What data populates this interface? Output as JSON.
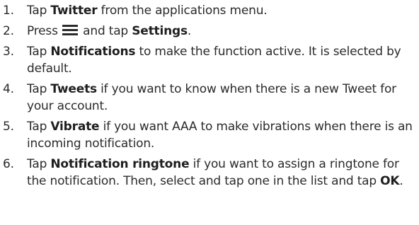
{
  "steps": [
    {
      "number": "1.",
      "parts": [
        {
          "t": "Tap ",
          "b": false
        },
        {
          "t": "Twitter",
          "b": true
        },
        {
          "t": " from the applications menu.",
          "b": false
        }
      ]
    },
    {
      "number": "2.",
      "parts": [
        {
          "t": "Press ",
          "b": false
        },
        {
          "icon": "menu-icon"
        },
        {
          "t": " and tap ",
          "b": false
        },
        {
          "t": "Settings",
          "b": true
        },
        {
          "t": ".",
          "b": false
        }
      ]
    },
    {
      "number": "3.",
      "parts": [
        {
          "t": "Tap ",
          "b": false
        },
        {
          "t": "Notifications",
          "b": true
        },
        {
          "t": " to make the function active. It is selected by default.",
          "b": false
        }
      ]
    },
    {
      "number": "4.",
      "parts": [
        {
          "t": "Tap ",
          "b": false
        },
        {
          "t": "Tweets",
          "b": true
        },
        {
          "t": " if you want to know when there is a new Tweet for your account.",
          "b": false
        }
      ]
    },
    {
      "number": "5.",
      "parts": [
        {
          "t": "Tap ",
          "b": false
        },
        {
          "t": "Vibrate",
          "b": true
        },
        {
          "t": " if you want AAA to make vibrations when there is an incoming notification.",
          "b": false
        }
      ]
    },
    {
      "number": "6.",
      "parts": [
        {
          "t": "Tap ",
          "b": false
        },
        {
          "t": "Notification ringtone",
          "b": true
        },
        {
          "t": " if you want to assign a ringtone for the notification. Then, select and tap one in the list and tap ",
          "b": false
        },
        {
          "t": "OK",
          "b": true
        },
        {
          "t": ".",
          "b": false
        }
      ]
    }
  ]
}
